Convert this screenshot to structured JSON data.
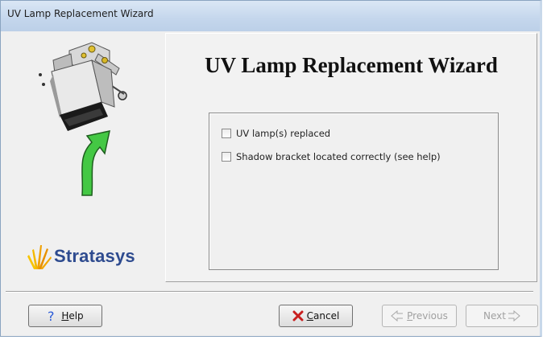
{
  "window": {
    "title": "UV Lamp Replacement Wizard"
  },
  "content": {
    "heading": "UV Lamp Replacement Wizard"
  },
  "brand": {
    "name": "Stratasys"
  },
  "checklist": [
    {
      "label": "UV lamp(s) replaced",
      "checked": false
    },
    {
      "label": "Shadow bracket located correctly (see help)",
      "checked": false
    }
  ],
  "buttons": {
    "help": {
      "mnemonic": "H",
      "rest": "elp",
      "icon": "question-icon"
    },
    "cancel": {
      "mnemonic": "C",
      "rest": "ancel",
      "icon": "red-x-icon"
    },
    "previous": {
      "mnemonic": "P",
      "rest": "revious",
      "icon": "back-arrow-icon",
      "enabled": false
    },
    "next": {
      "mnemonic": "",
      "rest": "Next",
      "icon": "forward-arrow-icon",
      "enabled": false
    }
  },
  "colors": {
    "brand_blue": "#2e4b8f",
    "arrow_green": "#3cc43c",
    "cancel_red": "#c81e1e",
    "help_blue": "#2a5bd8"
  }
}
